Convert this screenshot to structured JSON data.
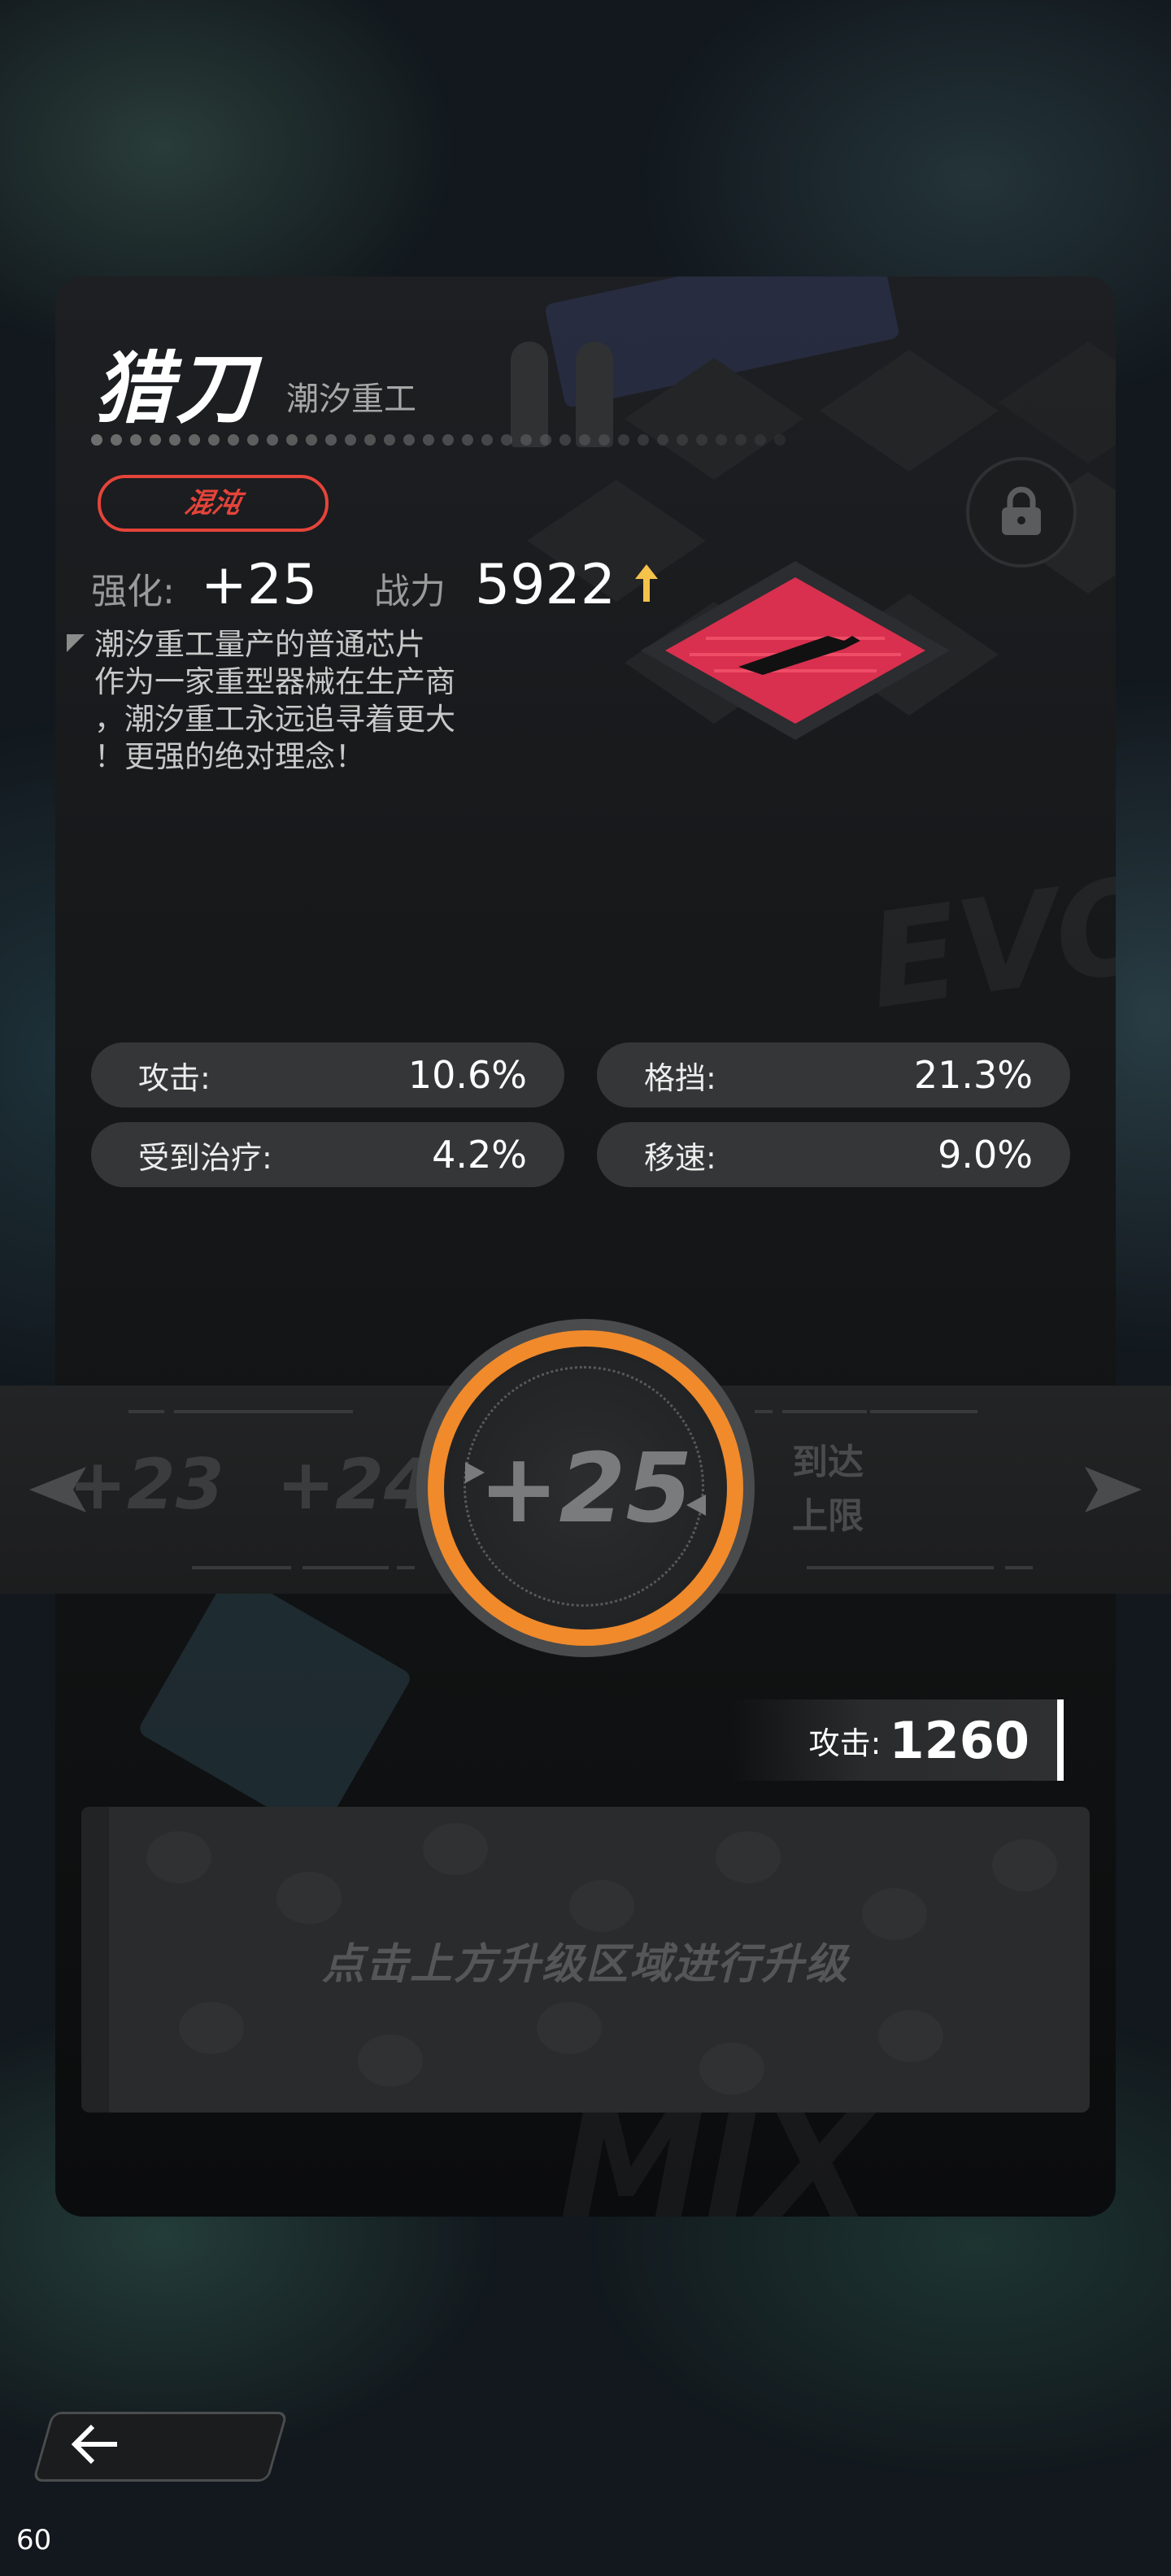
{
  "item": {
    "name": "猎刀",
    "maker": "潮汐重工",
    "tier": "混沌",
    "enhance_label": "强化:",
    "enhance_value": "+25",
    "power_label": "战力",
    "power_value": "5922",
    "description": [
      "潮汐重工量产的普通芯片",
      "作为一家重型器械在生产商",
      "，潮汐重工永远追寻着更大",
      "！更强的绝对理念！"
    ]
  },
  "stats": [
    {
      "label": "攻击:",
      "value": "10.6%"
    },
    {
      "label": "格挡:",
      "value": "21.3%"
    },
    {
      "label": "受到治疗:",
      "value": "4.2%"
    },
    {
      "label": "移速:",
      "value": "9.0%"
    }
  ],
  "level_selector": {
    "prev2": "+23",
    "prev1": "+24",
    "current": "+25",
    "max_line1": "到达",
    "max_line2": "上限"
  },
  "attack_bonus": {
    "label": "攻击:",
    "value": "1260"
  },
  "upgrade_hint": "点击上方升级区域进行升级",
  "fps": "60",
  "colors": {
    "tier": "#e5443a",
    "ring": "#f08a2b",
    "chip": "#d8304e",
    "arrow_up": "#f5c24a"
  },
  "icons": {
    "lock": "lock-icon",
    "back": "back-arrow-icon",
    "power_up": "arrow-up-icon"
  }
}
